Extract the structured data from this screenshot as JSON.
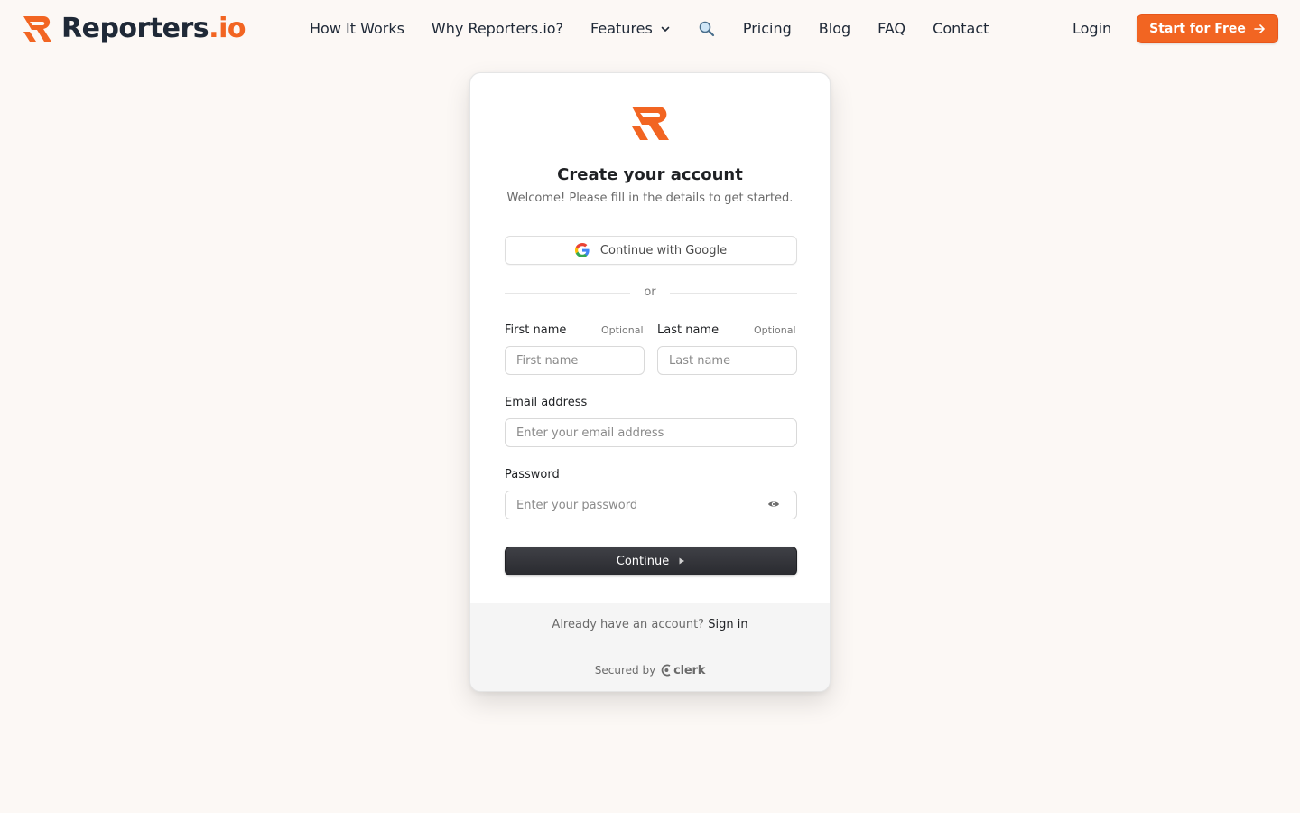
{
  "nav": {
    "brand_main": "Reporters",
    "brand_accent": ".io",
    "links": [
      {
        "label": "How It Works"
      },
      {
        "label": "Why Reporters.io?"
      },
      {
        "label": "Features"
      },
      {
        "label": "Pricing"
      },
      {
        "label": "Blog"
      },
      {
        "label": "FAQ"
      },
      {
        "label": "Contact"
      }
    ],
    "login": "Login",
    "cta": "Start for Free"
  },
  "card": {
    "title": "Create your account",
    "subtitle": "Welcome! Please fill in the details to get started.",
    "google_button": "Continue with Google",
    "divider": "or",
    "first_name": {
      "label": "First name",
      "optional": "Optional",
      "placeholder": "First name",
      "value": ""
    },
    "last_name": {
      "label": "Last name",
      "optional": "Optional",
      "placeholder": "Last name",
      "value": ""
    },
    "email": {
      "label": "Email address",
      "placeholder": "Enter your email address",
      "value": ""
    },
    "password": {
      "label": "Password",
      "placeholder": "Enter your password",
      "value": ""
    },
    "continue_button": "Continue",
    "have_account": "Already have an account?",
    "sign_in": "Sign in",
    "secured_by": "Secured by",
    "clerk": "clerk"
  },
  "colors": {
    "brand_orange": "#f26522",
    "page_bg": "#fcf8f5",
    "primary_button": "#2f3035"
  },
  "icons": {
    "search": "search-icon",
    "features_dropdown": "chevron-down-icon",
    "cta_arrow": "arrow-right-icon",
    "password_toggle": "eye-icon",
    "continue": "play-icon"
  }
}
